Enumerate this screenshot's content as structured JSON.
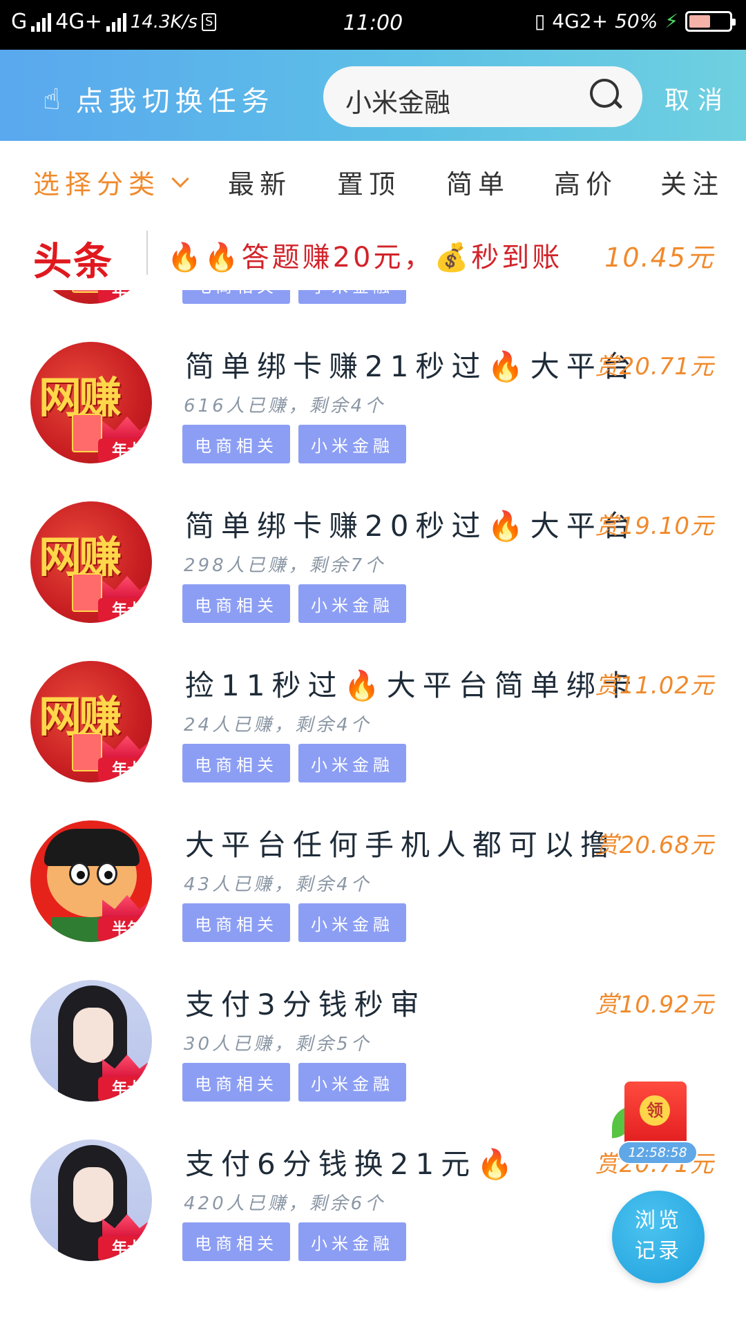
{
  "status_bar": {
    "carrier1": "G",
    "net1": "4G+",
    "speed": "14.3K/s",
    "s_badge": "S",
    "time": "11:00",
    "net2": "4G2+",
    "battery": "50%"
  },
  "header": {
    "switch_label": "点我切换任务",
    "search_value": "小米金融",
    "cancel_label": "取消"
  },
  "filters": {
    "category_label": "选择分类",
    "tabs": [
      "最新",
      "置顶",
      "简单",
      "高价",
      "关注"
    ]
  },
  "headline": {
    "logo": "头条",
    "text": "🔥🔥答题赚20元，💰秒到账",
    "price": "10.45元"
  },
  "tag_labels": [
    "电商相关",
    "小米金融"
  ],
  "tasks": [
    {
      "title": "",
      "reward": "",
      "meta": "",
      "badge": "年卡",
      "avatar": "wangzhuan"
    },
    {
      "title": "简单绑卡赚21秒过🔥大平台",
      "reward": "赏20.71元",
      "meta": "616人已赚，剩余4个",
      "badge": "年卡",
      "avatar": "wangzhuan"
    },
    {
      "title": "简单绑卡赚20秒过🔥大平台",
      "reward": "赏19.10元",
      "meta": "298人已赚，剩余7个",
      "badge": "年卡",
      "avatar": "wangzhuan"
    },
    {
      "title": "捡11秒过🔥大平台简单绑卡",
      "reward": "赏11.02元",
      "meta": "24人已赚，剩余4个",
      "badge": "年卡",
      "avatar": "wangzhuan"
    },
    {
      "title": "大平台任何手机人都可以撸",
      "reward": "赏20.68元",
      "meta": "43人已赚，剩余4个",
      "badge": "半年",
      "avatar": "cartoon"
    },
    {
      "title": "支付3分钱秒审",
      "reward": "赏10.92元",
      "meta": "30人已赚，剩余5个",
      "badge": "年卡",
      "avatar": "girl"
    },
    {
      "title": "支付6分钱换21元🔥",
      "reward": "赏20.71元",
      "meta": "420人已赚，剩余6个",
      "badge": "年卡",
      "avatar": "girl"
    }
  ],
  "avatar_text": "网赚",
  "red_packet": {
    "coin_label": "领",
    "timer": "12:58:58"
  },
  "history_button": {
    "line1": "浏览",
    "line2": "记录"
  },
  "colors": {
    "accent_orange": "#f08a2c",
    "tag_blue": "#8c9ef4",
    "header_blue": "#5aa8ee",
    "headline_red": "#e0191f"
  }
}
